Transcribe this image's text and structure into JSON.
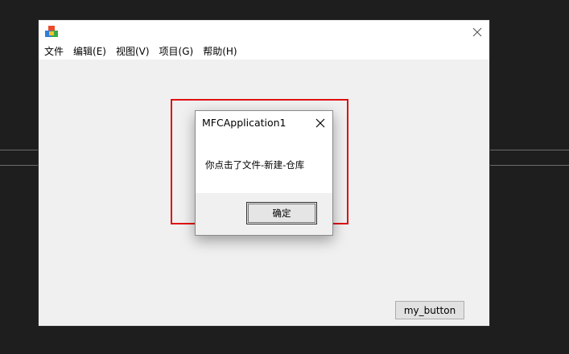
{
  "window": {
    "title": ""
  },
  "menu": {
    "items": [
      {
        "label": "文件"
      },
      {
        "label": "编辑(E)"
      },
      {
        "label": "视图(V)"
      },
      {
        "label": "项目(G)"
      },
      {
        "label": "帮助(H)"
      }
    ]
  },
  "client": {
    "button_label": "my_button"
  },
  "dialog": {
    "title": "MFCApplication1",
    "message": "你点击了文件-新建-仓库",
    "ok_label": "确定"
  },
  "colors": {
    "highlight": "#e01010",
    "desktop": "#1e1e1e",
    "client_bg": "#f0f0f0"
  }
}
